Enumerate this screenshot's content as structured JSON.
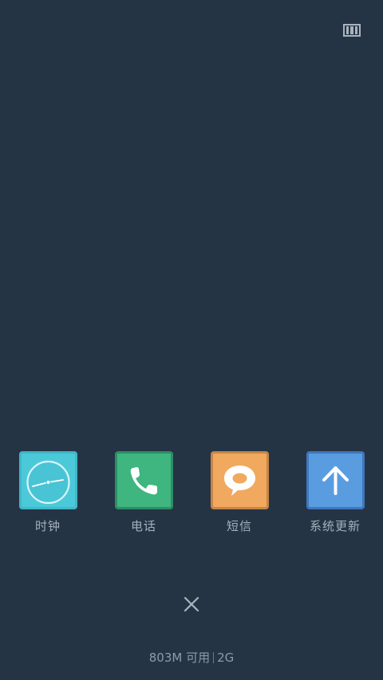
{
  "top_bar": {
    "view_toggle_icon": "list-view-icon"
  },
  "dock": {
    "apps": [
      {
        "label": "时钟",
        "icon": "clock-icon",
        "tile_color": "#4cc9d9",
        "frame_color": "#3fb7c9"
      },
      {
        "label": "电话",
        "icon": "phone-icon",
        "tile_color": "#3fb580",
        "frame_color": "#2c8f65"
      },
      {
        "label": "短信",
        "icon": "message-bubble-icon",
        "tile_color": "#f0a95f",
        "frame_color": "#c88646"
      },
      {
        "label": "系统更新",
        "icon": "arrow-up-icon",
        "tile_color": "#5a9ce0",
        "frame_color": "#3f78bd"
      }
    ]
  },
  "close_icon": "close-icon",
  "memory_status": {
    "available": "803M 可用",
    "total": "2G"
  }
}
